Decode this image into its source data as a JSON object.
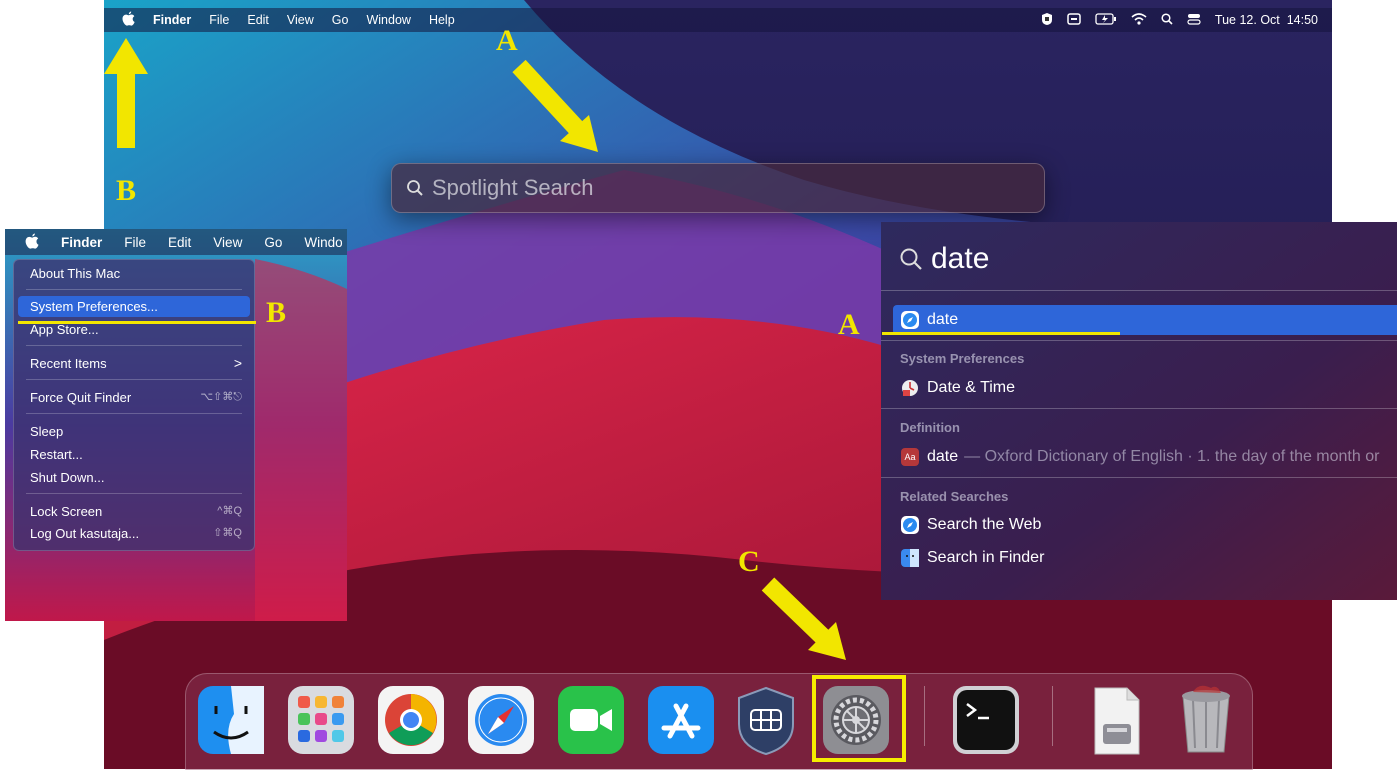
{
  "menubar": {
    "apple": "",
    "items": [
      "Finder",
      "File",
      "Edit",
      "View",
      "Go",
      "Window",
      "Help"
    ],
    "clock": "Tue 12. Oct  14:50"
  },
  "spotlight": {
    "placeholder": "Spotlight Search"
  },
  "inset_menu": {
    "bar_items": [
      "Finder",
      "File",
      "Edit",
      "View",
      "Go",
      "Windo"
    ],
    "items": {
      "about": "About This Mac",
      "sysprefs": "System Preferences...",
      "appstore": "App Store...",
      "recent": "Recent Items",
      "recent_arrow": ">",
      "forcequit": "Force Quit Finder",
      "forcequit_sc": "⌥⇧⌘⎋",
      "sleep": "Sleep",
      "restart": "Restart...",
      "shutdown": "Shut Down...",
      "lock": "Lock Screen",
      "lock_sc": "^⌘Q",
      "logout": "Log Out kasutaja...",
      "logout_sc": "⇧⌘Q"
    }
  },
  "results": {
    "query": "date",
    "top_hit": "date",
    "cat_sysprefs": "System Preferences",
    "date_time": "Date & Time",
    "cat_definition": "Definition",
    "def_word": "date",
    "def_text": "— Oxford Dictionary of English · 1. the day of the month or",
    "cat_related": "Related Searches",
    "search_web": "Search the Web",
    "search_finder": "Search in Finder"
  },
  "annotations": {
    "a1": "A",
    "a2": "A",
    "b1": "B",
    "b2": "B",
    "c": "C"
  },
  "colors": {
    "highlight": "#f2e600",
    "selection": "#2e66d9"
  },
  "dock_icons": [
    "finder-icon",
    "launchpad-icon",
    "chrome-icon",
    "safari-icon",
    "facetime-icon",
    "app-store-icon",
    "vpn-shield-icon",
    "system-preferences-icon",
    "terminal-icon",
    "document-icon",
    "trash-icon"
  ]
}
